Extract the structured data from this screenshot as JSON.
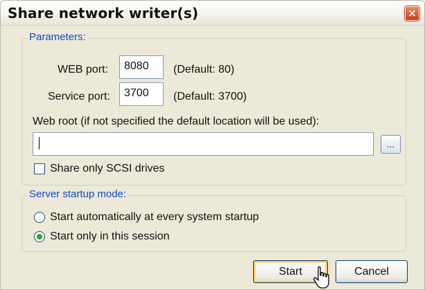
{
  "window": {
    "title": "Share network writer(s)",
    "close_glyph": "×"
  },
  "parameters": {
    "legend": "Parameters:",
    "web_port": {
      "label": "WEB port:",
      "value": "8080",
      "hint": "(Default: 80)"
    },
    "service_port": {
      "label": "Service port:",
      "value": "3700",
      "hint": "(Default: 3700)"
    },
    "web_root": {
      "label": "Web root (if not specified the default location will be used):",
      "value": "",
      "browse_label": "..."
    },
    "scsi_only": {
      "label": "Share only SCSI drives",
      "checked": false
    }
  },
  "startup_mode": {
    "legend": "Server startup mode:",
    "options": [
      {
        "label": "Start automatically at every system startup",
        "selected": false
      },
      {
        "label": "Start only in this session",
        "selected": true
      }
    ]
  },
  "buttons": {
    "start": "Start",
    "cancel": "Cancel"
  },
  "icons": {
    "close": "close-icon",
    "cursor": "mouse-pointer-icon"
  },
  "colors": {
    "legend_text": "#1648c8",
    "window_bg": "#ece9d8",
    "radio_dot": "#2ca52c",
    "close_btn": "#cc3a18"
  }
}
